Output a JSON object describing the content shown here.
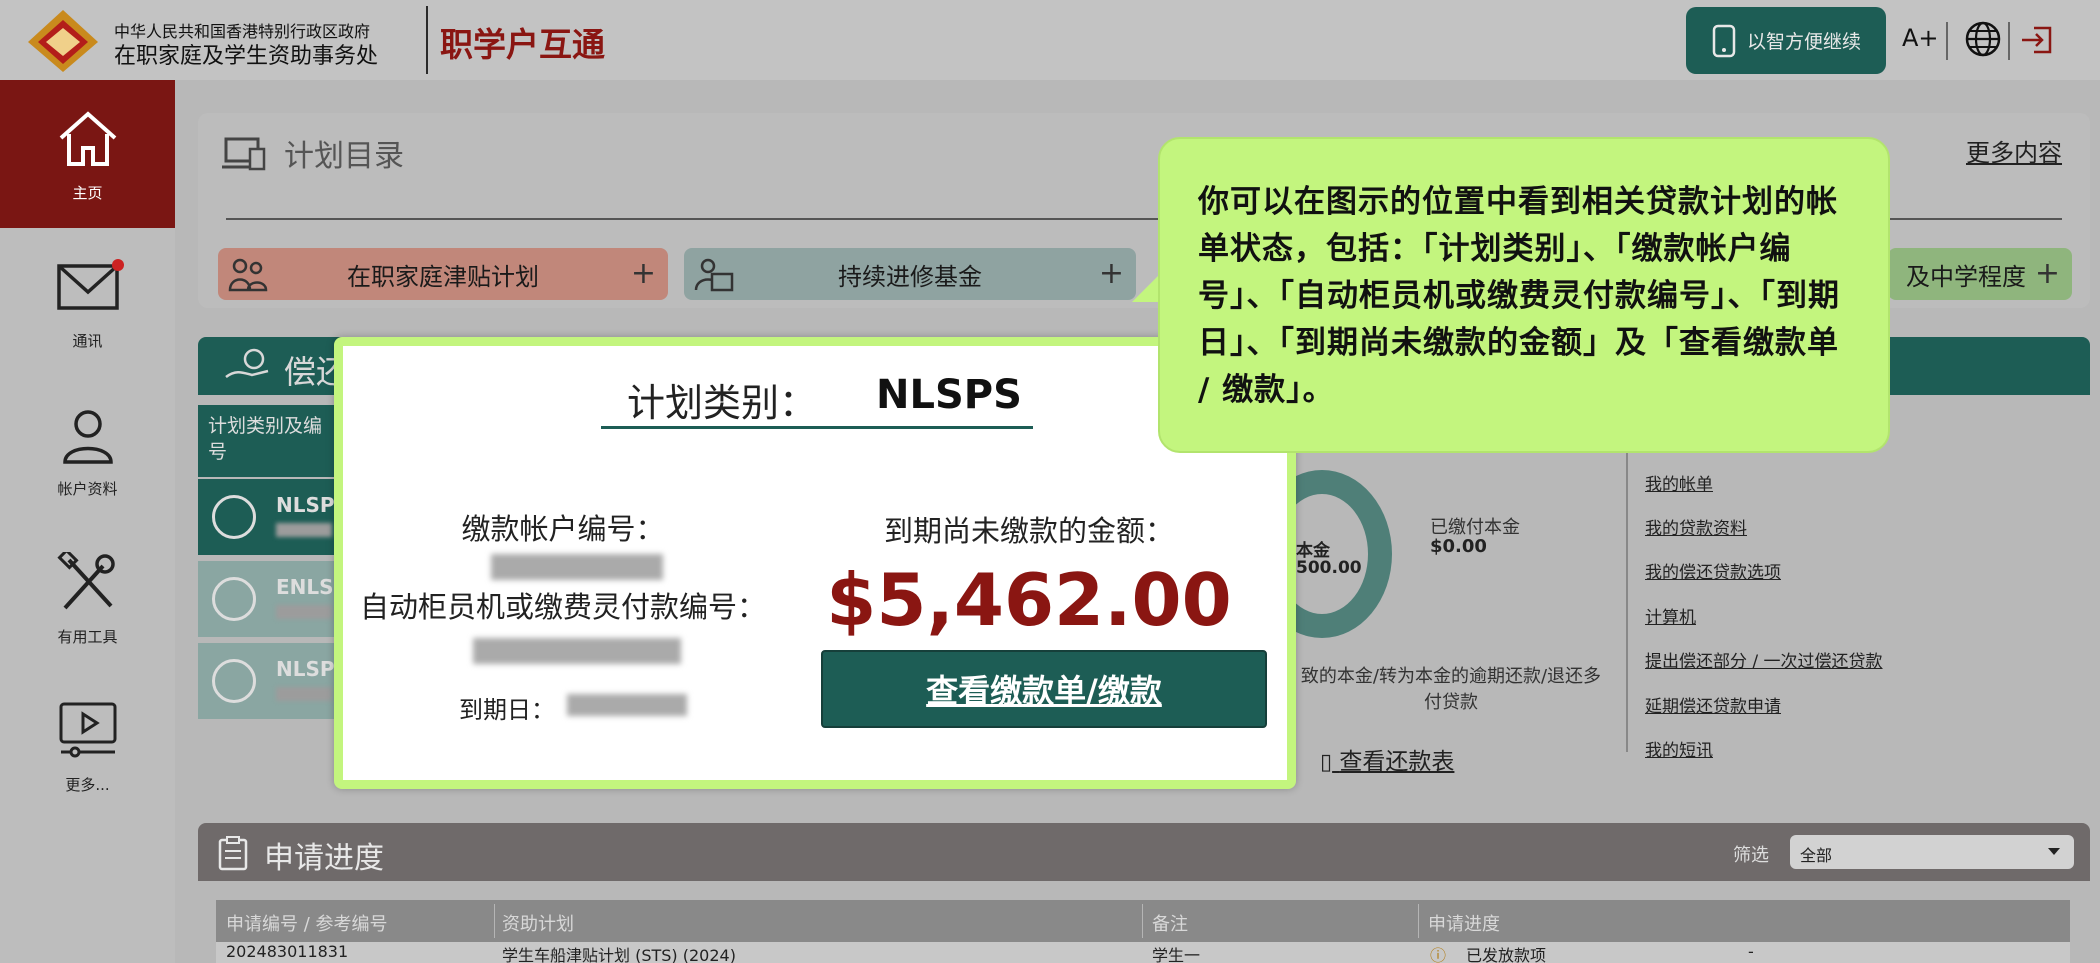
{
  "header": {
    "org_line1": "中华人民共和国香港特别行政区政府",
    "org_line2": "在职家庭及学生资助事务处",
    "brand": "职学户互通",
    "smart_login": "以智方便继续",
    "font_size": "A+"
  },
  "sidebar": {
    "items": [
      {
        "label": "主页"
      },
      {
        "label": "通讯"
      },
      {
        "label": "帐户资料"
      },
      {
        "label": "有用工具"
      },
      {
        "label": "更多..."
      }
    ]
  },
  "plans": {
    "title": "计划目录",
    "more": "更多内容",
    "buttons": [
      {
        "label": "在职家庭津贴计划"
      },
      {
        "label": "持续进修基金"
      },
      {
        "label": "及中学程度"
      }
    ]
  },
  "repay": {
    "title": "偿还",
    "col_head": "计划类别及编号",
    "rows": [
      {
        "name": "NLSP"
      },
      {
        "name": "ENLS"
      },
      {
        "name": "NLSP"
      }
    ],
    "donut_label": "本金",
    "donut_value": "500.00",
    "paid_title": "已缴付本金",
    "paid_value": "$0.00",
    "note": "致的本金/转为本金的逾期还款/退还多付贷款",
    "schedule": "查看还款表",
    "links": [
      "我的帐单",
      "我的贷款资料",
      "我的偿还贷款选项",
      "计算机",
      "提出偿还部分 / 一次过偿还贷款",
      "延期偿还贷款申请",
      "我的短讯"
    ]
  },
  "application": {
    "title": "申请进度",
    "filter_label": "筛选",
    "filter_value": "全部",
    "columns": [
      "申请编号 / 参考编号",
      "资助计划",
      "备注",
      "申请进度"
    ],
    "row": {
      "id": "202483011831",
      "scheme": "学生车船津贴计划 (STS) (2024)",
      "remark": "学生一",
      "status": "已发放款项",
      "extra": "-"
    }
  },
  "focus": {
    "type_label": "计划类别：",
    "type_value": "NLSPS",
    "account_label": "缴款帐户编号：",
    "atm_label": "自动柜员机或缴费灵付款编号：",
    "due_label": "到期日：",
    "amount_label": "到期尚未缴款的金额：",
    "amount": "$5,462.00",
    "bill_button": "查看缴款单/缴款"
  },
  "callout": {
    "text": "你可以在图示的位置中看到相关贷款计划的帐单状态，包括：「计划类别」、「缴款帐户编号」、「自动柜员机或缴费灵付款编号」、「到期日」、「到期尚未缴款的金额」及「查看缴款单 / 缴款」。"
  },
  "colors": {
    "brand_red": "#8a1612",
    "teal": "#1d5d55",
    "highlight": "#c3f57e"
  }
}
